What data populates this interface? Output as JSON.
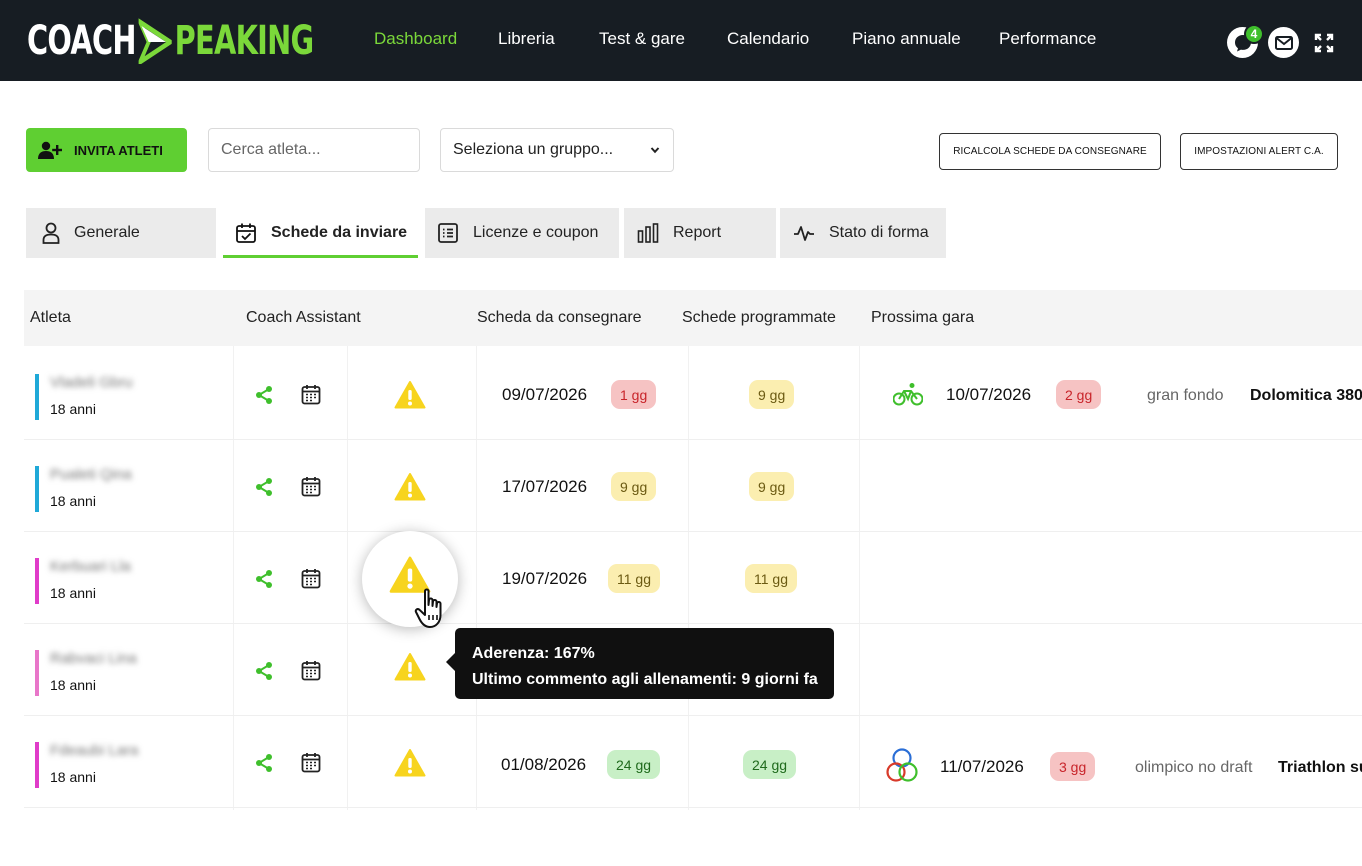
{
  "brand": {
    "part1": "COACH",
    "part2": "PEAKING"
  },
  "nav": {
    "items": [
      "Dashboard",
      "Libreria",
      "Test & gare",
      "Calendario",
      "Piano annuale",
      "Performance"
    ],
    "active": "Dashboard"
  },
  "header": {
    "chat_badge": "4",
    "icons": [
      "chat-icon",
      "mail-icon",
      "fullscreen-icon"
    ]
  },
  "toolbar": {
    "invite_label": "INVITA ATLETI",
    "search_placeholder": "Cerca atleta...",
    "group_select": "Seleziona un gruppo...",
    "recalc_label": "RICALCOLA SCHEDE DA CONSEGNARE",
    "alert_settings_label": "IMPOSTAZIONI ALERT C.A."
  },
  "tabs": [
    {
      "label": "Generale",
      "icon": "user-icon"
    },
    {
      "label": "Schede da inviare",
      "icon": "calendar-check-icon",
      "active": true
    },
    {
      "label": "Licenze e coupon",
      "icon": "list-icon"
    },
    {
      "label": "Report",
      "icon": "bar-chart-icon"
    },
    {
      "label": "Stato di forma",
      "icon": "pulse-icon"
    }
  ],
  "table": {
    "columns": [
      "Atleta",
      "Coach Assistant",
      "Scheda da consegnare",
      "Schede programmate",
      "Prossima gara"
    ],
    "rows": [
      {
        "name": "Vladeli Gbru",
        "age": "18 anni",
        "bar": "#1fa9d8",
        "due_date": "09/07/2026",
        "due_pill": "1 gg",
        "due_color": "red",
        "programmed": "9 gg",
        "prog_color": "yellow",
        "race": {
          "icon": "bike-icon",
          "date": "10/07/2026",
          "pill": "2 gg",
          "type": "gran fondo",
          "name": "Dolomitica 380"
        }
      },
      {
        "name": "Pualeti Qina",
        "age": "18 anni",
        "bar": "#1fa9d8",
        "due_date": "17/07/2026",
        "due_pill": "9 gg",
        "due_color": "yellow",
        "programmed": "9 gg",
        "prog_color": "yellow"
      },
      {
        "name": "Kerbuari Lla",
        "age": "18 anni",
        "bar": "#e03cc9",
        "due_date": "19/07/2026",
        "due_pill": "11 gg",
        "due_color": "yellow",
        "programmed": "11 gg",
        "prog_color": "yellow"
      },
      {
        "name": "Rabvaci Lina",
        "age": "18 anni",
        "bar": "#e876c9",
        "due_date": "",
        "due_pill": "",
        "programmed": ""
      },
      {
        "name": "Fdeaubi Lara",
        "age": "18 anni",
        "bar": "#e03cc9",
        "due_date": "01/08/2026",
        "due_pill": "24 gg",
        "due_color": "green",
        "programmed": "24 gg",
        "prog_color": "green",
        "race": {
          "icon": "triathlon-rings-icon",
          "date": "11/07/2026",
          "pill": "3 gg",
          "type": "olimpico no draft",
          "name": "Triathlon su"
        }
      }
    ]
  },
  "tooltip": {
    "line1": "Aderenza: 167%",
    "line2": "Ultimo commento agli allenamenti: 9 giorni fa"
  },
  "colors": {
    "accent": "#5fcf32",
    "nav_bg": "#171d23",
    "warning": "#f7d41e"
  }
}
